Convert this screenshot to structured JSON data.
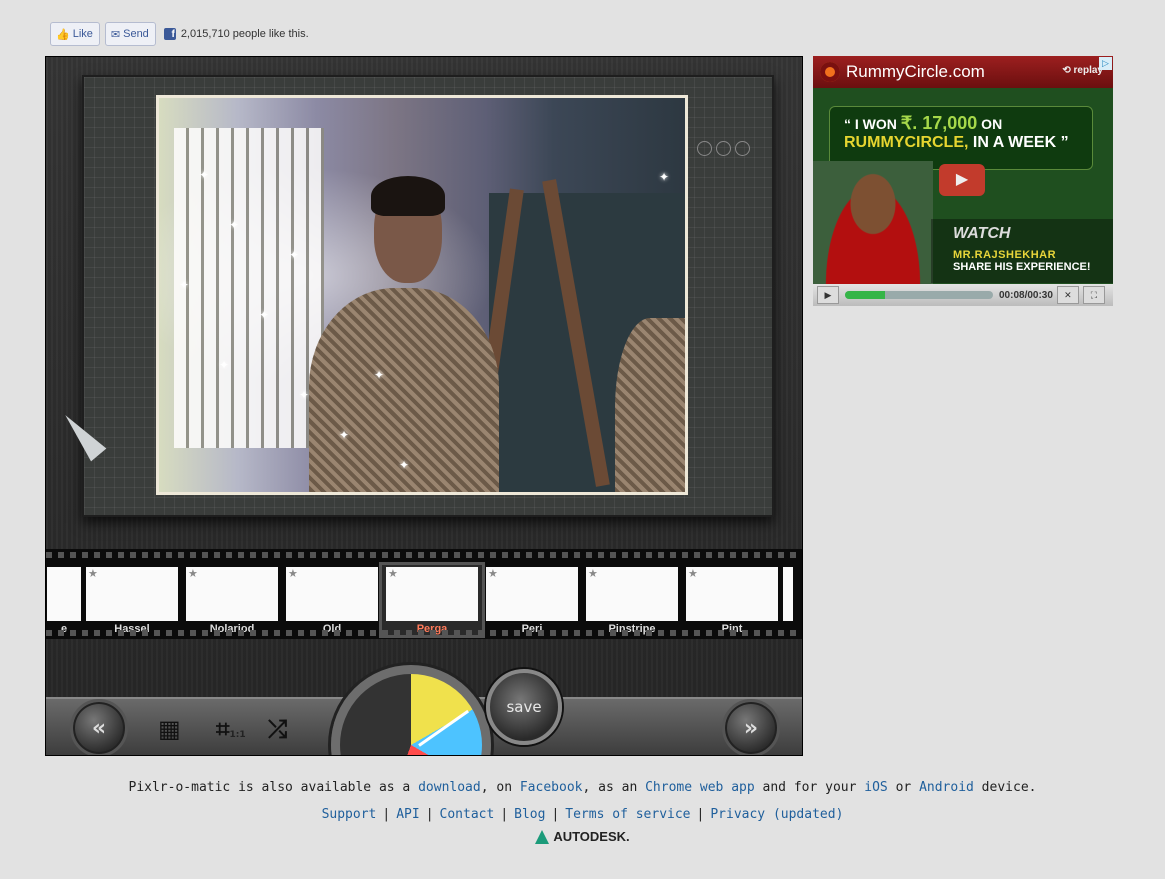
{
  "facebook": {
    "like_label": "Like",
    "send_label": "Send",
    "count_text": "2,015,710 people like this."
  },
  "app": {
    "filters": [
      {
        "label": "e",
        "selected": false
      },
      {
        "label": "Hassel",
        "selected": false
      },
      {
        "label": "Nolariod",
        "selected": false
      },
      {
        "label": "Old",
        "selected": false
      },
      {
        "label": "Perga",
        "selected": true
      },
      {
        "label": "Peri",
        "selected": false
      },
      {
        "label": "Pinstripe",
        "selected": false
      },
      {
        "label": "Pint",
        "selected": false
      }
    ],
    "controls": {
      "prev_glyph": "«",
      "next_glyph": "»",
      "save_label": "save",
      "crop_ratio": "1:1"
    }
  },
  "ad": {
    "brand": "RummyCircle.com",
    "replay": "replay",
    "quote_prefix": "“ I WON ",
    "amount": "₹. 17,000",
    "quote_mid": " ON",
    "quote_brand": "RUMMYCIRCLE,",
    "quote_tail": " IN A WEEK ”",
    "watch": "WATCH",
    "name": "MR.RAJSHEKHAR",
    "share": "SHARE HIS EXPERIENCE!",
    "time": "00:08/00:30",
    "progress": 0.27
  },
  "footer": {
    "line_parts": {
      "t1": "Pixlr-o-matic is also available as a ",
      "download": "download",
      "t2": ", on ",
      "facebook": "Facebook",
      "t3": ", as an ",
      "chrome": "Chrome web app",
      "t4": " and for your ",
      "ios": "iOS",
      "t5": " or ",
      "android": "Android",
      "t6": " device."
    },
    "links": [
      "Support",
      "API",
      "Contact",
      "Blog",
      "Terms of service",
      "Privacy (updated)"
    ],
    "brand": "AUTODESK."
  }
}
